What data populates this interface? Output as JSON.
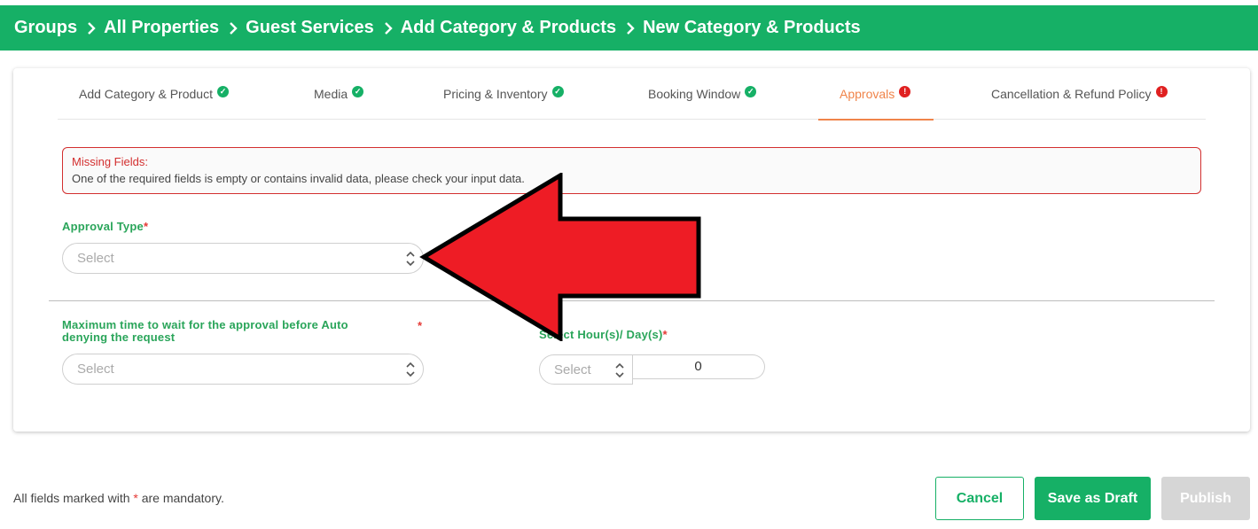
{
  "breadcrumb": [
    "Groups",
    "All Properties",
    "Guest Services",
    "Add Category & Products",
    "New Category & Products"
  ],
  "tabs": [
    {
      "label": "Add Category & Product",
      "status": "complete"
    },
    {
      "label": "Media",
      "status": "complete"
    },
    {
      "label": "Pricing & Inventory",
      "status": "complete"
    },
    {
      "label": "Booking Window",
      "status": "complete"
    },
    {
      "label": "Approvals",
      "status": "error",
      "active": true
    },
    {
      "label": "Cancellation & Refund Policy",
      "status": "error"
    }
  ],
  "alert": {
    "title": "Missing Fields:",
    "message": "One of the required fields is empty or contains invalid data, please check your input data."
  },
  "form": {
    "approval_type": {
      "label": "Approval Type",
      "required_mark": "*",
      "placeholder": "Select"
    },
    "max_wait": {
      "label_line1": "Maximum time to wait for the approval before Auto",
      "label_line2": "denying the request",
      "required_mark": "*",
      "placeholder": "Select"
    },
    "hours_days": {
      "label": "Select Hour(s)/ Day(s)",
      "required_mark": "*",
      "placeholder": "Select",
      "value": "0"
    }
  },
  "footer": {
    "note_prefix": "All fields marked with ",
    "note_mark": "*",
    "note_suffix": " are mandatory.",
    "cancel_label": "Cancel",
    "draft_label": "Save as Draft",
    "publish_label": "Publish"
  },
  "colors": {
    "brand_green": "#16b066",
    "active_tab": "#f0844a",
    "error_red": "#d32f2f",
    "annotation_arrow": "#ee1c25"
  },
  "icons": {
    "breadcrumb_separator": "chevron-right-icon",
    "tab_complete": "check-circle-icon",
    "tab_error": "exclamation-circle-icon",
    "select_toggle": "chevron-up-down-icon"
  }
}
